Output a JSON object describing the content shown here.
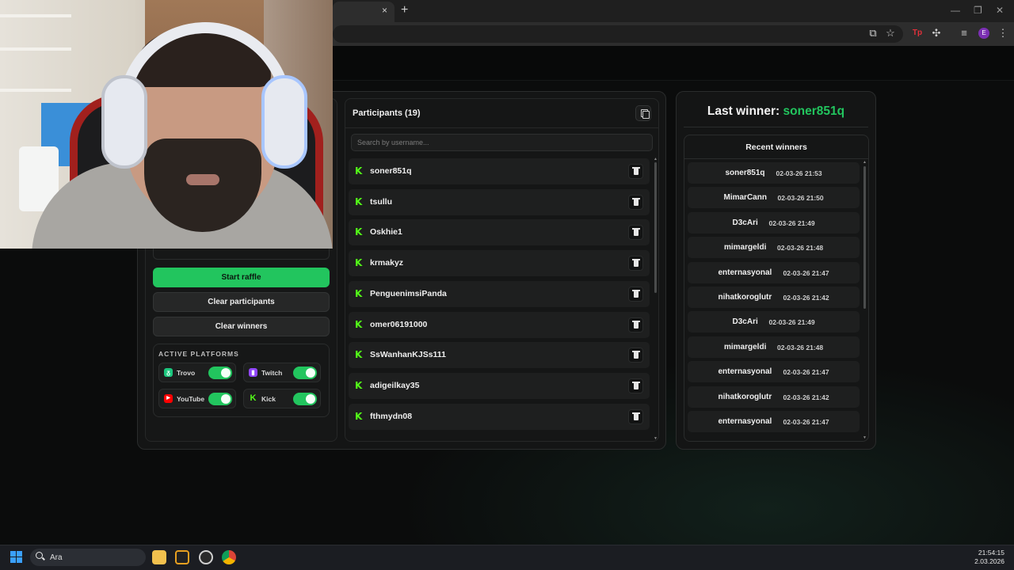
{
  "browser": {
    "tab_close": "×",
    "new_tab": "+",
    "window_controls": [
      "—",
      "❐",
      "✕"
    ],
    "toolbar_icons": [
      "translate-icon",
      "star-icon",
      "extension-icon",
      "puzzle-icon",
      "media-icon",
      "profile-icon",
      "menu-icon"
    ],
    "profile_initial": "E"
  },
  "colors": {
    "accent": "#22c55e",
    "kick_green": "#53fc18",
    "twitch_purple": "#9146ff",
    "youtube_red": "#ff0000",
    "trovo_green": "#1cc77e"
  },
  "controls": {
    "start_raffle": "Start raffle",
    "clear_participants": "Clear participants",
    "clear_winners": "Clear winners"
  },
  "platforms": {
    "title": "ACTIVE PLATFORMS",
    "items": [
      {
        "label": "Trovo",
        "icon": "trovo-icon",
        "enabled": true
      },
      {
        "label": "Twitch",
        "icon": "twitch-icon",
        "enabled": true
      },
      {
        "label": "YouTube",
        "icon": "youtube-icon",
        "enabled": true
      },
      {
        "label": "Kick",
        "icon": "kick-icon",
        "enabled": true
      }
    ]
  },
  "participants": {
    "title": "Participants (19)",
    "search_placeholder": "Search by username...",
    "items": [
      "soner851q",
      "tsullu",
      "Oskhie1",
      "krmakyz",
      "PenguenimsiPanda",
      "omer06191000",
      "SsWanhanKJSs111",
      "adigeilkay35",
      "fthmydn08"
    ]
  },
  "last_winner": {
    "label": "Last winner:",
    "name": "soner851q"
  },
  "recent_winners": {
    "title": "Recent winners",
    "items": [
      {
        "name": "soner851q",
        "time": "02-03-26 21:53"
      },
      {
        "name": "MimarCann",
        "time": "02-03-26 21:50"
      },
      {
        "name": "D3cAri",
        "time": "02-03-26 21:49"
      },
      {
        "name": "mimargeldi",
        "time": "02-03-26 21:48"
      },
      {
        "name": "enternasyonal",
        "time": "02-03-26 21:47"
      },
      {
        "name": "nihatkoroglutr",
        "time": "02-03-26 21:42"
      },
      {
        "name": "D3cAri",
        "time": "02-03-26 21:49"
      },
      {
        "name": "mimargeldi",
        "time": "02-03-26 21:48"
      },
      {
        "name": "enternasyonal",
        "time": "02-03-26 21:47"
      },
      {
        "name": "nihatkoroglutr",
        "time": "02-03-26 21:42"
      },
      {
        "name": "enternasyonal",
        "time": "02-03-26 21:47"
      }
    ]
  },
  "taskbar": {
    "search_text": "Ara",
    "apps": [
      "file-explorer-icon",
      "app-r-icon",
      "app-gear-icon",
      "chrome-icon"
    ],
    "time": "21:54:15",
    "date": "2.03.2026"
  }
}
